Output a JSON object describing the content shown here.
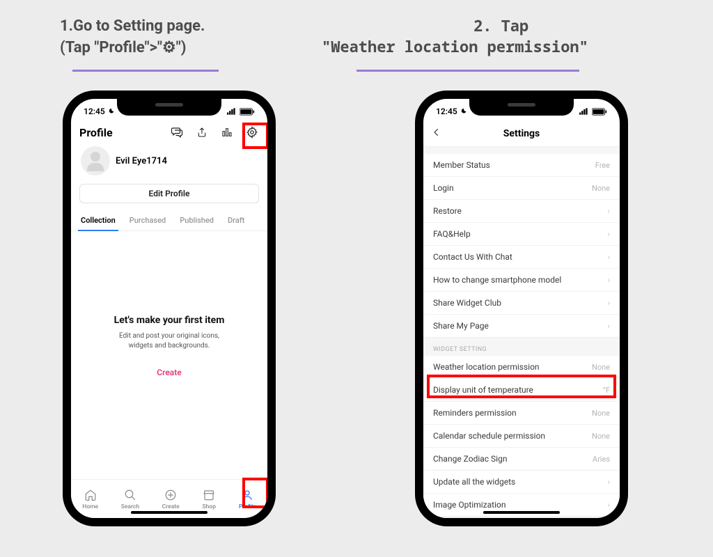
{
  "captions": {
    "step1_a": "1.Go to Setting page.",
    "step1_b": "(Tap \"Profile\">\"⚙\")",
    "step2_a": "2. Tap",
    "step2_b": "\"Weather location permission\""
  },
  "status": {
    "time": "12:45",
    "cell": "▪▪",
    "signal": "▮▮▮▮",
    "battery": "100"
  },
  "profile": {
    "header_title": "Profile",
    "username": "Evil Eye1714",
    "edit_button": "Edit Profile",
    "tabs": [
      {
        "label": "Collection",
        "active": true
      },
      {
        "label": "Purchased",
        "active": false
      },
      {
        "label": "Published",
        "active": false
      },
      {
        "label": "Draft",
        "active": false
      }
    ],
    "empty": {
      "title": "Let's make your first item",
      "body_l1": "Edit and post your original icons,",
      "body_l2": "widgets and backgrounds.",
      "cta": "Create"
    },
    "tabbar": [
      {
        "label": "Home"
      },
      {
        "label": "Search"
      },
      {
        "label": "Create"
      },
      {
        "label": "Shop"
      },
      {
        "label": "Profile",
        "active": true
      }
    ]
  },
  "settings": {
    "nav_title": "Settings",
    "groups": [
      {
        "rows": [
          {
            "label": "Member Status",
            "value": "Free"
          },
          {
            "label": "Login",
            "value": "None"
          },
          {
            "label": "Restore",
            "chevron": true
          },
          {
            "label": "FAQ&Help",
            "chevron": true
          },
          {
            "label": "Contact Us With Chat",
            "chevron": true
          },
          {
            "label": "How to change smartphone model",
            "chevron": true
          },
          {
            "label": "Share Widget Club",
            "chevron": true
          },
          {
            "label": "Share My Page",
            "chevron": true
          }
        ]
      },
      {
        "section": "WIDGET SETTING",
        "rows": [
          {
            "label": "Weather location permission",
            "value": "None",
            "highlight": true
          },
          {
            "label": "Display unit of temperature",
            "value": "°F"
          },
          {
            "label": "Reminders permission",
            "value": "None"
          },
          {
            "label": "Calendar schedule permission",
            "value": "None"
          },
          {
            "label": "Change Zodiac Sign",
            "value": "Aries"
          },
          {
            "label": "Update all the widgets",
            "chevron": true
          },
          {
            "label": "Image Optimization",
            "chevron": true
          }
        ]
      }
    ]
  }
}
